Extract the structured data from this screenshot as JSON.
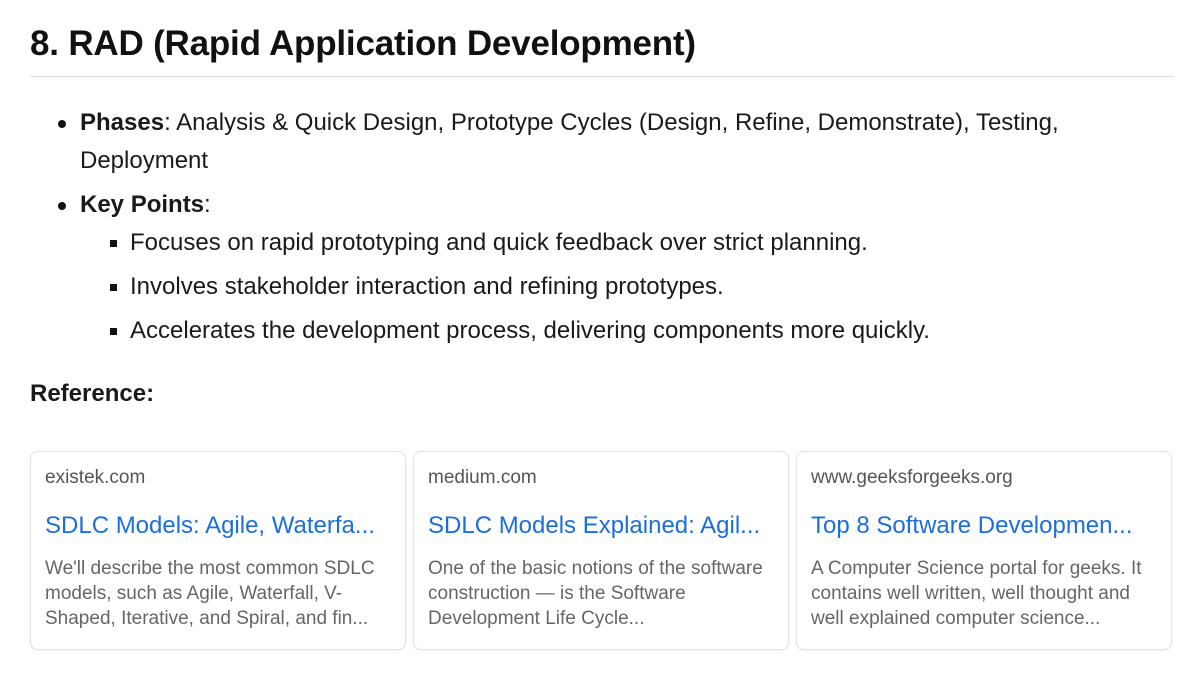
{
  "section": {
    "title": "8. RAD (Rapid Application Development)"
  },
  "bullets": {
    "phases": {
      "label": "Phases",
      "text": ": Analysis & Quick Design, Prototype Cycles (Design, Refine, Demonstrate), Testing, Deployment"
    },
    "key_points": {
      "label": "Key Points",
      "text": ":",
      "items": [
        "Focuses on rapid prototyping and quick feedback over strict planning.",
        "Involves stakeholder interaction and refining prototypes.",
        "Accelerates the development process, delivering components more quickly."
      ]
    }
  },
  "reference": {
    "heading": "Reference:",
    "cards": [
      {
        "domain": "existek.com",
        "title": "SDLC Models: Agile, Waterfa...",
        "snippet": "We'll describe the most common SDLC models, such as Agile, Waterfall, V-Shaped, Iterative, and Spiral, and fin..."
      },
      {
        "domain": "medium.com",
        "title": "SDLC Models Explained: Agil...",
        "snippet": "One of the basic notions of the software construction — is the Software Development Life Cycle..."
      },
      {
        "domain": "www.geeksforgeeks.org",
        "title": "Top 8 Software Developmen...",
        "snippet": "A Computer Science portal for geeks. It contains well written, well thought and well explained computer science..."
      }
    ]
  }
}
